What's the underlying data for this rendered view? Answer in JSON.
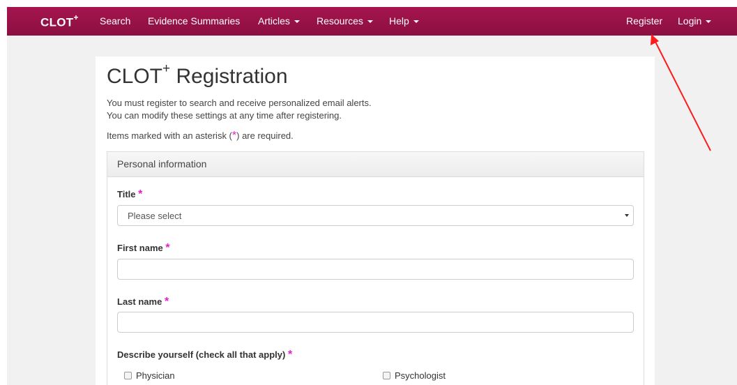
{
  "navbar": {
    "brand": "CLOT",
    "brand_sup": "+",
    "items": [
      {
        "label": "Search"
      },
      {
        "label": "Evidence Summaries"
      },
      {
        "label": "Articles"
      },
      {
        "label": "Resources"
      },
      {
        "label": "Help"
      }
    ],
    "right_items": [
      {
        "label": "Register"
      },
      {
        "label": "Login"
      }
    ]
  },
  "page": {
    "title": "CLOT",
    "title_sup": "+",
    "title_rest": " Registration",
    "intro_line1": "You must register to search and receive personalized email alerts.",
    "intro_line2": "You can modify these settings at any time after registering.",
    "required_pre": "Items marked with an asterisk (",
    "required_star": "*",
    "required_post": ") are required."
  },
  "form": {
    "section_title": "Personal information",
    "title_label": "Title",
    "title_select_value": "Please select",
    "first_name_label": "First name",
    "first_name_value": "",
    "last_name_label": "Last name",
    "last_name_value": "",
    "describe_label": "Describe yourself (check all that apply)",
    "required_marker": "*",
    "options": [
      {
        "label": "Physician"
      },
      {
        "label": "Psychologist"
      }
    ]
  },
  "colors": {
    "navbar": "#96124a",
    "required_star": "#e51dcc",
    "annotation_arrow": "#ff1a1a"
  }
}
